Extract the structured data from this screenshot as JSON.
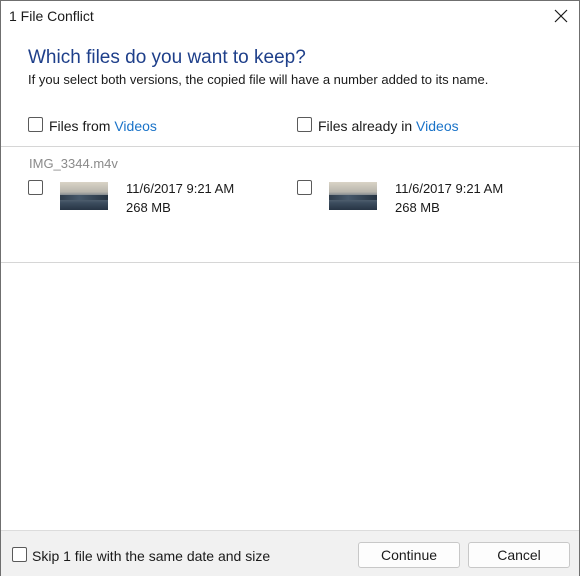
{
  "window": {
    "title": "1 File Conflict",
    "close_icon": "close-icon"
  },
  "header": {
    "heading": "Which files do you want to keep?",
    "subtext": "If you select both versions, the copied file will have a number added to its name."
  },
  "columns": {
    "left": {
      "prefix": "Files from ",
      "folder": "Videos",
      "checked": false
    },
    "right": {
      "prefix": "Files already in ",
      "folder": "Videos",
      "checked": false
    }
  },
  "conflict": {
    "filename": "IMG_3344.m4v",
    "left": {
      "date": "11/6/2017 9:21 AM",
      "size": "268 MB",
      "checked": false
    },
    "right": {
      "date": "11/6/2017 9:21 AM",
      "size": "268 MB",
      "checked": false
    }
  },
  "footer": {
    "skip_label": "Skip 1 file with the same date and size",
    "skip_checked": false,
    "continue_label": "Continue",
    "cancel_label": "Cancel"
  },
  "colors": {
    "heading": "#1e3f8a",
    "link": "#1a73c8",
    "footer_bg": "#f1f1f1"
  }
}
